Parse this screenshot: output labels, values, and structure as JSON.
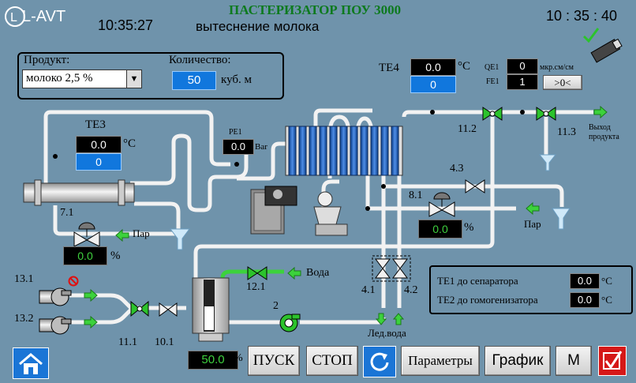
{
  "header": {
    "title": "ПАСТЕРИЗАТОР ПОУ 3000",
    "mode": "вытеснение молока",
    "clock_left": "10:35:27",
    "clock_right": "10 : 35 : 40",
    "logo_text": "L-AVT"
  },
  "product_panel": {
    "product_label": "Продукт:",
    "product_value": "молоко 2,5 %",
    "quantity_label": "Количество:",
    "quantity_value": "50",
    "quantity_unit": "куб. м"
  },
  "te3": {
    "label": "TE3",
    "value": "0.0",
    "setpoint": "0",
    "unit": "°C"
  },
  "te4": {
    "label": "TE4",
    "value": "0.0",
    "setpoint": "0",
    "unit": "°C"
  },
  "pe1": {
    "label": "PE1",
    "value": "0.0",
    "unit": "Bar"
  },
  "qe1": {
    "label": "QE1",
    "value": "0",
    "unit": "мкр.см/см"
  },
  "fe1": {
    "label": "FE1",
    "value": "1",
    "button": ">0<"
  },
  "valve_steam_71": {
    "label": "7.1",
    "value": "0.0",
    "unit": "%",
    "steam": "Пар"
  },
  "valve_steam_81": {
    "label": "8.1",
    "value": "0.0",
    "unit": "%",
    "steam": "Пар"
  },
  "tank": {
    "value": "50.0",
    "unit": "%"
  },
  "valves": {
    "v112": "11.2",
    "v113": "11.3",
    "v43": "4.3",
    "v41": "4.1",
    "v42": "4.2",
    "v121": "12.1",
    "v111": "11.1",
    "v101": "10.1",
    "p2": "2",
    "p131": "13.1",
    "p132": "13.2"
  },
  "flows": {
    "product_out": "Выход продукта",
    "water": "Вода",
    "ice_water": "Лед.вода"
  },
  "temps_panel": {
    "te1_label": "TE1 до сепаратора",
    "te1_value": "0.0",
    "te1_unit": "°C",
    "te2_label": "TE2 до гомогенизатора",
    "te2_value": "0.0",
    "te2_unit": "°C"
  },
  "toolbar": {
    "start": "ПУСК",
    "stop": "СТОП",
    "params": "Параметры",
    "graph": "График",
    "m": "M"
  },
  "colors": {
    "background": "#6f93ab",
    "pipe": "#f2f2f2",
    "valve_green": "#2cc32c",
    "display_blue": "#1177dd"
  }
}
